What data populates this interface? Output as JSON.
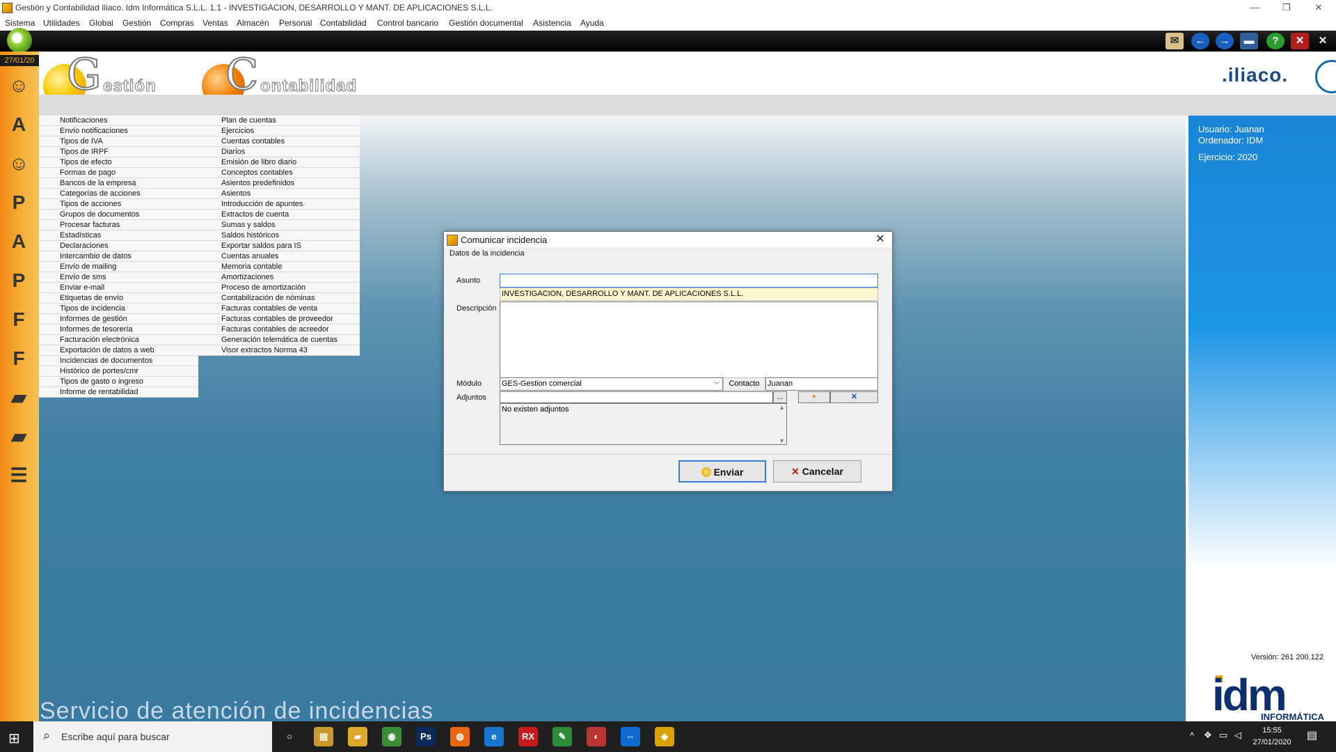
{
  "window": {
    "title": "Gestión y Contabilidad Iliaco. Idm Informática S.L.L. 1.1 - INVESTIGACION, DESARROLLO Y MANT. DE APLICACIONES S.L.L.",
    "minimize": "—",
    "restore": "❐",
    "close": "✕"
  },
  "menu": [
    "Sistema",
    "Utilidades",
    "Global",
    "Gestión",
    "Compras",
    "Ventas",
    "Almacén",
    "Personal",
    "Contabilidad",
    "Control bancario",
    "Gestión documental",
    "Asistencia",
    "Ayuda"
  ],
  "toolbar_icons": [
    "mail-icon",
    "back-icon",
    "forward-icon",
    "window-icon",
    "help-icon",
    "close-icon",
    "exit-icon"
  ],
  "toolbar_glyphs": {
    "help": "?",
    "back": "←",
    "forward": "→",
    "close": "✕",
    "exit": "✕",
    "window": "▬",
    "mail": "✉"
  },
  "sidebar": {
    "date": "27/01/20",
    "icons": [
      {
        "name": "users-icon",
        "glyph": "☺"
      },
      {
        "name": "agenda-icon",
        "glyph": "A"
      },
      {
        "name": "user-icon",
        "glyph": "☺"
      },
      {
        "name": "provider-icon",
        "glyph": "P"
      },
      {
        "name": "creditor-icon",
        "glyph": "A"
      },
      {
        "name": "purchase-icon",
        "glyph": "P"
      },
      {
        "name": "invoice-icon",
        "glyph": "F"
      },
      {
        "name": "fc-icon",
        "glyph": "F"
      },
      {
        "name": "book-icon",
        "glyph": "▰"
      },
      {
        "name": "folder-icon",
        "glyph": "▰"
      },
      {
        "name": "list-icon",
        "glyph": "☰"
      }
    ]
  },
  "banner": {
    "gestion_initial": "G",
    "gestion_word": "estión",
    "contabilidad_initial": "C",
    "contabilidad_word": "ontabilidad",
    "brand": ".iliaco."
  },
  "gestion_menu": [
    "Notificaciones",
    "Envío notificaciones",
    "Tipos de IVA",
    "Tipos de IRPF",
    "Tipos de efecto",
    "Formas de pago",
    "Bancos de la empresa",
    "Categorías de acciones",
    "Tipos de acciones",
    "Grupos de documentos",
    "Procesar facturas",
    "Estadísticas",
    "Declaraciones",
    "Intercambio de datos",
    "Envío de mailing",
    "Envío de sms",
    "Enviar e-mail",
    "Etiquetas de envío",
    "Tipos de incidencia",
    "Informes de gestión",
    "Informes de tesorería",
    "Facturación electrónica",
    "Exportación de datos a web",
    "Incidencias de documentos",
    "Histórico de portes/cmr",
    "Tipos de gasto o ingreso",
    "Informe de rentabilidad"
  ],
  "contabilidad_menu": [
    "Plan de cuentas",
    "Ejercicios",
    "Cuentas contables",
    "Diarios",
    "Emisión de libro diario",
    "Conceptos contables",
    "Asientos predefinidos",
    "Asientos",
    "Introducción de apuntes",
    "Extractos de cuenta",
    "Sumas y saldos",
    "Saldos históricos",
    "Exportar saldos para IS",
    "Cuentas anuales",
    "Memoria contable",
    "Amortizaciones",
    "Proceso de amortización",
    "Contabilización de nóminas",
    "Facturas contables de venta",
    "Facturas contables de proveedor",
    "Facturas contables de acreedor",
    "Generación telemática de cuentas",
    "Visor extractos Norma 43"
  ],
  "footer_title": "Servicio de atención de incidencias",
  "user_panel": {
    "usuario": "Usuario: Juanan",
    "ordenador": "Ordenador: IDM",
    "ejercicio": "Ejercicio: 2020",
    "version": "Versión: 261 200.122",
    "logo_main": "idm",
    "logo_sub": "INFORMÁTICA"
  },
  "dialog": {
    "title": "Comunicar incidencia",
    "group_label": "Datos de la incidencia",
    "asunto_label": "Asunto",
    "asunto_value": "",
    "company_value": "INVESTIGACION, DESARROLLO Y MANT. DE APLICACIONES S.L.L.",
    "descripcion_label": "Descripción",
    "descripcion_value": "",
    "modulo_label": "Módulo",
    "modulo_value": "GES-Gestion comercial",
    "contacto_label": "Contacto",
    "contacto_value": "Juanan",
    "adjuntos_label": "Adjuntos",
    "adjuntos_browse": "...",
    "adjuntos_empty": "No existen adjuntos",
    "enviar_label": "Enviar",
    "cancelar_label": "Cancelar"
  },
  "taskbar": {
    "search_placeholder": "Escribe aquí para buscar",
    "time": "15:55",
    "date": "27/01/2020",
    "apps": [
      {
        "name": "task-view-icon",
        "glyph": "○",
        "color": "#1f1f1f"
      },
      {
        "name": "file-manager-icon",
        "glyph": "▤",
        "color": "#c99a2a"
      },
      {
        "name": "folder-icon",
        "glyph": "▰",
        "color": "#e0a82a"
      },
      {
        "name": "chrome-icon",
        "glyph": "◉",
        "color": "#3a8e3a"
      },
      {
        "name": "photoshop-icon",
        "glyph": "Ps",
        "color": "#0a2a5a"
      },
      {
        "name": "firefox-icon",
        "glyph": "◍",
        "color": "#e8660e"
      },
      {
        "name": "edge-icon",
        "glyph": "e",
        "color": "#1676d2"
      },
      {
        "name": "rx-icon",
        "glyph": "RX",
        "color": "#c41a1a"
      },
      {
        "name": "notepad-icon",
        "glyph": "✎",
        "color": "#2e8b3a"
      },
      {
        "name": "app-icon",
        "glyph": "◐",
        "color": "#b33"
      },
      {
        "name": "teamviewer-icon",
        "glyph": "⇔",
        "color": "#0e6bd0"
      },
      {
        "name": "gestion-app-icon",
        "glyph": "◆",
        "color": "#d8a200"
      }
    ]
  }
}
